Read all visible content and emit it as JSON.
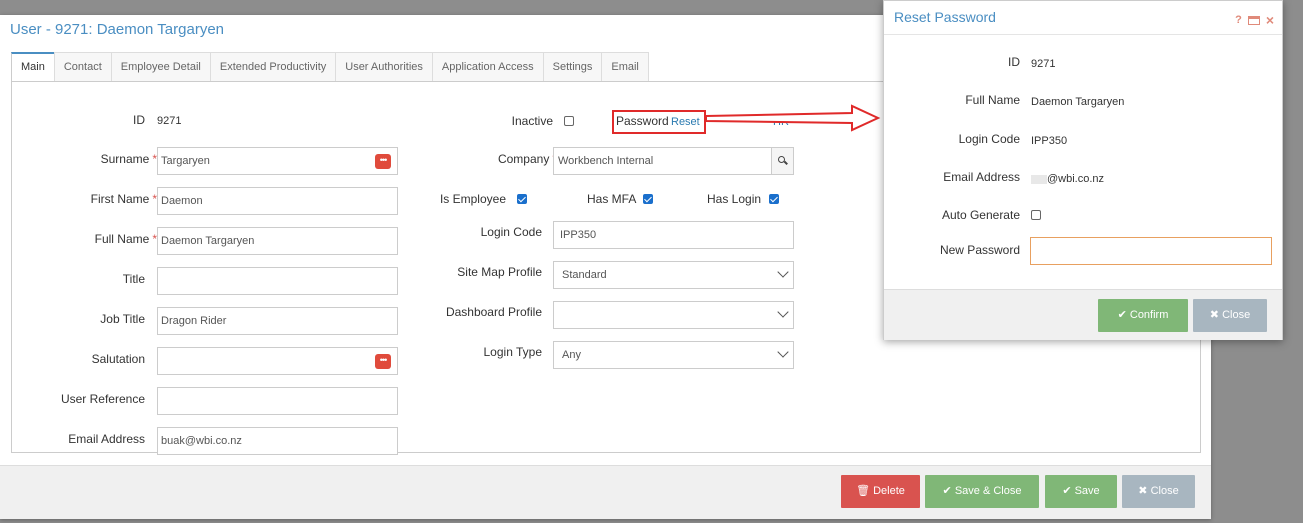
{
  "window": {
    "title": "User - 9271: Daemon Targaryen"
  },
  "tabs": [
    "Main",
    "Contact",
    "Employee Detail",
    "Extended Productivity",
    "User Authorities",
    "Application Access",
    "Settings",
    "Email"
  ],
  "main": {
    "id_label": "ID",
    "id_value": "9271",
    "surname_label": "Surname",
    "surname_value": "Targaryen",
    "first_name_label": "First Name",
    "first_name_value": "Daemon",
    "full_name_label": "Full Name",
    "full_name_value": "Daemon Targaryen",
    "title_label": "Title",
    "title_value": "",
    "job_title_label": "Job Title",
    "job_title_value": "Dragon Rider",
    "salutation_label": "Salutation",
    "salutation_value": "",
    "user_reference_label": "User Reference",
    "user_reference_value": "",
    "email_label": "Email Address",
    "email_value": "buak@wbi.co.nz",
    "inactive_label": "Inactive",
    "inactive_checked": false,
    "password_label": "Password",
    "reset_link": "Reset",
    "hr_link": "HR",
    "company_label": "Company",
    "company_value": "Workbench Internal",
    "is_employee_label": "Is Employee",
    "is_employee_checked": true,
    "has_mfa_label": "Has MFA",
    "has_mfa_checked": true,
    "has_login_label": "Has Login",
    "has_login_checked": true,
    "login_code_label": "Login Code",
    "login_code_value": "IPP350",
    "site_map_label": "Site Map Profile",
    "site_map_value": "Standard",
    "dashboard_label": "Dashboard Profile",
    "dashboard_value": "",
    "login_type_label": "Login Type",
    "login_type_value": "Any"
  },
  "footer": {
    "delete": "Delete",
    "save_close": "Save & Close",
    "save": "Save",
    "close": "Close"
  },
  "dialog": {
    "title": "Reset Password",
    "icons": [
      "help-icon",
      "window-icon",
      "close-icon"
    ],
    "help_glyph": "?",
    "close_glyph": "×",
    "id_label": "ID",
    "id_value": "9271",
    "full_name_label": "Full Name",
    "full_name_value": "Daemon Targaryen",
    "login_code_label": "Login Code",
    "login_code_value": "IPP350",
    "email_label": "Email Address",
    "email_value": "@wbi.co.nz",
    "auto_generate_label": "Auto Generate",
    "auto_generate_checked": false,
    "new_password_label": "New Password",
    "new_password_value": "",
    "confirm": "Confirm",
    "close": "Close"
  },
  "colors": {
    "accent": "#4a8ec2",
    "danger": "#d9534f",
    "success": "#80b777",
    "muted": "#a8b6c0",
    "annotation": "#e02a2a"
  }
}
